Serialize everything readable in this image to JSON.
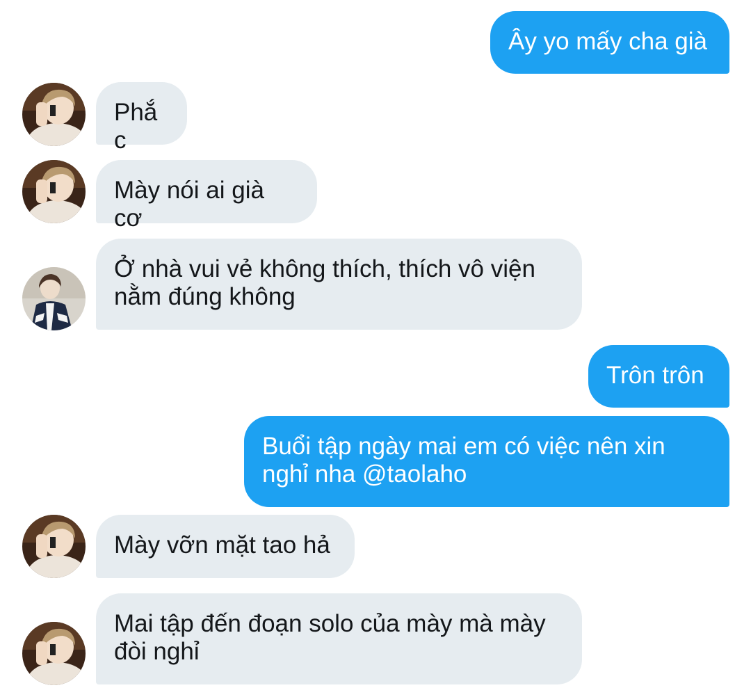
{
  "conversation": {
    "messages": [
      {
        "direction": "outgoing",
        "text": "Ây yo mấy cha già"
      },
      {
        "direction": "incoming",
        "avatar": "avatar-a",
        "text": "Phắc"
      },
      {
        "direction": "incoming",
        "avatar": "avatar-a",
        "text": "Mày nói ai già cơ"
      },
      {
        "direction": "incoming",
        "avatar": "avatar-b",
        "text": "Ở nhà vui vẻ không thích, thích vô viện nằm đúng không"
      },
      {
        "direction": "outgoing",
        "text": "Trôn trôn"
      },
      {
        "direction": "outgoing",
        "text": "Buổi tập ngày mai em có việc nên xin nghỉ nha @taolaho"
      },
      {
        "direction": "incoming",
        "avatar": "avatar-a",
        "text": "Mày vỡn mặt tao hả"
      },
      {
        "direction": "incoming",
        "avatar": "avatar-a",
        "text": "Mai tập đến đoạn solo của mày mà mày đòi nghỉ"
      }
    ]
  },
  "colors": {
    "outgoing_bubble": "#1da1f2",
    "incoming_bubble": "#e6ecf0",
    "outgoing_text": "#ffffff",
    "incoming_text": "#14171a",
    "background": "#ffffff"
  }
}
